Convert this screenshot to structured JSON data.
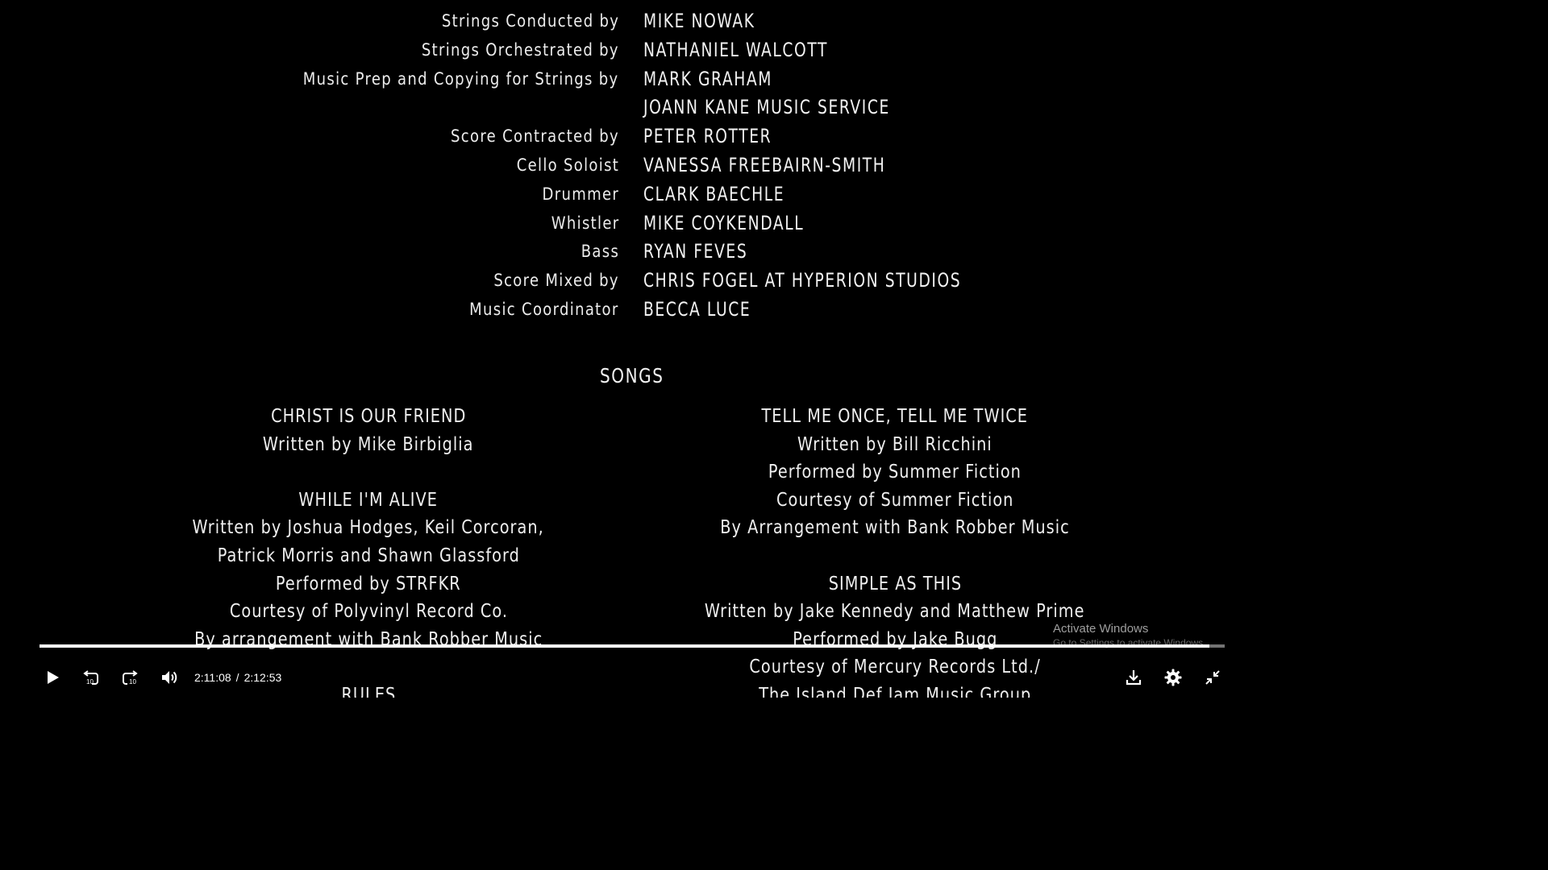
{
  "credits": [
    {
      "role": "Strings Conducted by",
      "name": "MIKE NOWAK"
    },
    {
      "role": "Strings Orchestrated by",
      "name": "NATHANIEL WALCOTT"
    },
    {
      "role": "Music Prep and Copying for Strings by",
      "name": "MARK GRAHAM"
    },
    {
      "role": "",
      "name": "JoANN KANE MUSIC SERVICE"
    },
    {
      "role": "Score Contracted by",
      "name": "PETER ROTTER"
    },
    {
      "role": "Cello Soloist",
      "name": "VANESSA FREEBAIRN-SMITH"
    },
    {
      "role": "Drummer",
      "name": "CLARK BAECHLE"
    },
    {
      "role": "Whistler",
      "name": "MIKE COYKENDALL"
    },
    {
      "role": "Bass",
      "name": "RYAN FEVES"
    },
    {
      "role": "Score Mixed by",
      "name": "CHRIS FOGEL AT HYPERION STUDIOS"
    },
    {
      "role": "Music Coordinator",
      "name": "BECCA LUCE"
    }
  ],
  "songs_title": "SONGS",
  "songs_left": [
    "CHRIST IS OUR FRIEND",
    "Written by Mike Birbiglia",
    "",
    "WHILE I'M ALIVE",
    "Written by Joshua Hodges, Keil Corcoran,",
    "Patrick Morris and Shawn Glassford",
    "Performed by STRFKR",
    "Courtesy of Polyvinyl Record Co.",
    "By arrangement with Bank Robber Music",
    "",
    "RULES"
  ],
  "songs_right": [
    "TELL ME ONCE, TELL ME TWICE",
    "Written by Bill Ricchini",
    "Performed by Summer Fiction",
    "Courtesy of Summer Fiction",
    "By Arrangement with Bank Robber Music",
    "",
    "SIMPLE AS THIS",
    "Written by Jake Kennedy and Matthew Prime",
    "Performed by Jake Bugg",
    "Courtesy of Mercury Records Ltd./",
    "The Island Def Jam Music Group"
  ],
  "watermark": {
    "title": "Activate Windows",
    "subtitle": "Go to Settings to activate Windows."
  },
  "player": {
    "current_time": "2:11:08",
    "separator": "/",
    "duration": "2:12:53",
    "progress_fraction": 0.987,
    "icons": {
      "play": "play-icon",
      "rewind": "rewind-10-icon",
      "forward": "forward-10-icon",
      "volume": "volume-icon",
      "download": "download-icon",
      "settings": "gear-icon",
      "exit_fullscreen": "exit-fullscreen-icon"
    }
  }
}
